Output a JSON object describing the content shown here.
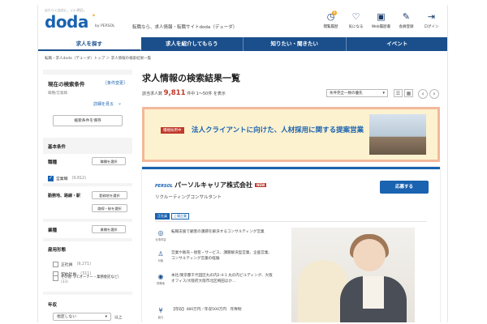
{
  "header": {
    "tagline": "はたらく自分に、いい明日。",
    "logo": "doda",
    "by": "by PERSOL",
    "site_desc": "転職なら、求人情報・転職サイトdoda（デューダ）",
    "icons": [
      {
        "icon": "clock-icon",
        "glyph": "◷",
        "label": "閲覧履歴",
        "badge": "9"
      },
      {
        "icon": "heart-icon",
        "glyph": "♡",
        "label": "気になる"
      },
      {
        "icon": "briefcase-icon",
        "glyph": "▣",
        "label": "Web履歴書"
      },
      {
        "icon": "edit-icon",
        "glyph": "✎",
        "label": "会員登録"
      },
      {
        "icon": "login-icon",
        "glyph": "⇥",
        "label": "ログイン"
      }
    ]
  },
  "nav": {
    "items": [
      "求人を探す",
      "求人を紹介してもらう",
      "知りたい・聞きたい",
      "イベント"
    ],
    "active": 0
  },
  "breadcrumb": "転職・求人doda（デューダ）トップ ＞ 求人情報の検索結果一覧",
  "sidebar": {
    "current_title": "現在の検索条件",
    "change_link": "［条件変更］",
    "current_value": "職種/営業職",
    "detail_link": "詳細を見る",
    "save_button": "検索条件を保存",
    "basic_title": "基本条件",
    "job_type_title": "職種",
    "job_type_select": "職種を選択",
    "job_type_checked": "営業職",
    "job_type_count": "(9,812)",
    "location_title": "勤務地、路線・駅",
    "location_select": "勤務地を選択",
    "station_select": "路線・駅を選択",
    "industry_title": "業種",
    "industry_select": "業種を選択",
    "employment_title": "雇用形態",
    "employment_items": [
      {
        "label": "正社員",
        "count": "(9,271)"
      },
      {
        "label": "契約社員",
        "count": "(311)"
      },
      {
        "label": "その他（FCオーナー・業務委託など）",
        "count": "(33)"
      }
    ],
    "salary_title": "年収",
    "salary_value": "指定しない",
    "salary_suffix": "以上"
  },
  "main": {
    "title": "求人情報の検索結果一覧",
    "count_prefix": "該当求人数",
    "count": "9,811",
    "count_suffix": "件中 1～50件 を表示",
    "sort_label": "条件完全一致の優先",
    "view_list": "☰",
    "view_grid": "▦",
    "prev": "‹",
    "next": "›"
  },
  "banner": {
    "tag": "積極採用中",
    "text": "法人クライアントに向けた、人材採用に関する提案営業"
  },
  "job": {
    "company_logo": "PERSOL",
    "company": "パーソルキャリア株式会社",
    "new_badge": "NEW",
    "job_type": "リクルーティングコンサルタント",
    "tags": [
      "正社員",
      "上場企業"
    ],
    "apply": "応募する",
    "info": [
      {
        "icon": "building-icon",
        "glyph": "◎",
        "label": "仕事内容",
        "text": "転職支援で顧客の課題を解決するコンサルティング営業"
      },
      {
        "icon": "person-icon",
        "glyph": "♙",
        "label": "対象",
        "text": "営業や販売・接客・サービス、課題解決型営業、企画営業、コンサルティング営業の経験"
      },
      {
        "icon": "location-icon",
        "glyph": "◉",
        "label": "勤務地",
        "text": "本社/東京都千代田区丸の内2-4-1 丸の内ビルディング、大阪オフィス/大阪府大阪市北区梅田ほか…"
      },
      {
        "icon": "yen-icon",
        "glyph": "¥",
        "label": "給与",
        "text": "【年収】480万円／年収500万円　年俸制"
      }
    ]
  },
  "colors": {
    "brand": "#1a63b0",
    "nav": "#1a4f8c",
    "accent_red": "#c0392b",
    "banner_bg": "#fdf2d0",
    "banner_border": "#f3b89a"
  }
}
